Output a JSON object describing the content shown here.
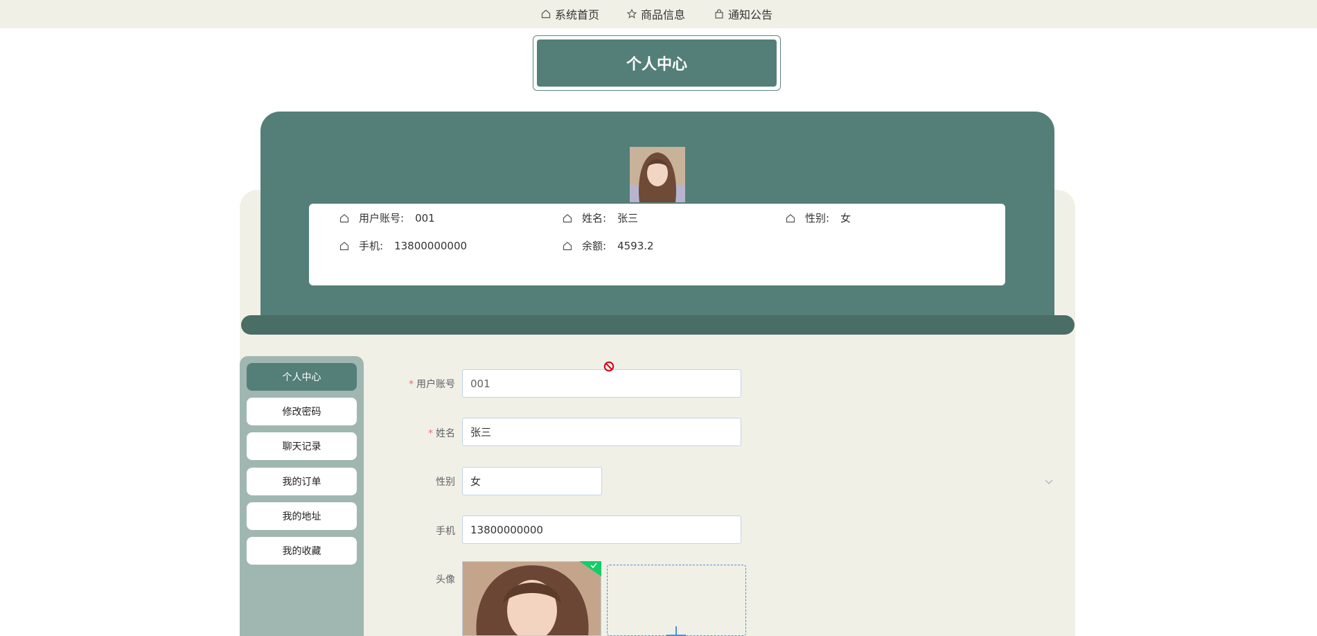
{
  "nav": {
    "items": [
      {
        "label": "系统首页",
        "icon": "home-icon"
      },
      {
        "label": "商品信息",
        "icon": "star-icon"
      },
      {
        "label": "通知公告",
        "icon": "bag-icon"
      }
    ]
  },
  "page_title": "个人中心",
  "profile": {
    "fields": [
      {
        "label": "用户账号:",
        "value": "001"
      },
      {
        "label": "姓名:",
        "value": "张三"
      },
      {
        "label": "性别:",
        "value": "女"
      },
      {
        "label": "手机:",
        "value": "13800000000"
      },
      {
        "label": "余额:",
        "value": "4593.2"
      }
    ]
  },
  "menu": {
    "items": [
      "个人中心",
      "修改密码",
      "聊天记录",
      "我的订单",
      "我的地址",
      "我的收藏"
    ],
    "active": "个人中心"
  },
  "form": {
    "account": {
      "label": "用户账号",
      "value": "001",
      "required": true
    },
    "name": {
      "label": "姓名",
      "value": "张三",
      "required": true
    },
    "gender": {
      "label": "性别",
      "value": "女"
    },
    "phone": {
      "label": "手机",
      "value": "13800000000"
    },
    "avatar": {
      "label": "头像"
    },
    "required_mark": "*"
  },
  "colors": {
    "accent": "#537f78",
    "panel": "#f0f0e6",
    "menu_bg": "#9fb7b0",
    "required": "#f56c6c"
  }
}
